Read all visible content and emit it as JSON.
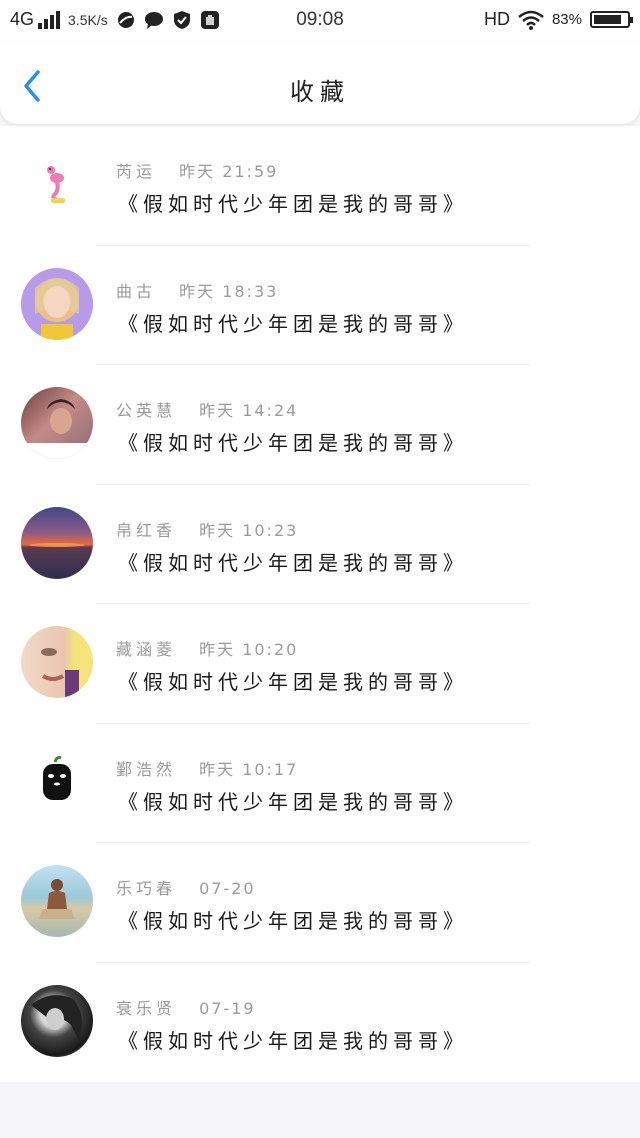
{
  "status_bar": {
    "network": "4G",
    "speed": "3.5K/s",
    "time": "09:08",
    "hd": "HD",
    "battery": "83%",
    "battery_level": 0.83
  },
  "nav": {
    "title": "收藏",
    "back_icon": "chevron-left-icon"
  },
  "items": [
    {
      "name": "芮运",
      "time": "昨天 21:59",
      "content": "《假如时代少年团是我的哥哥》",
      "avatar": "flamingo-sticker"
    },
    {
      "name": "曲古",
      "time": "昨天 18:33",
      "content": "《假如时代少年团是我的哥哥》",
      "avatar": "blonde-girl-photo"
    },
    {
      "name": "公英慧",
      "time": "昨天 14:24",
      "content": "《假如时代少年团是我的哥哥》",
      "avatar": "girl-selfie-photo"
    },
    {
      "name": "帛红香",
      "time": "昨天 10:23",
      "content": "《假如时代少年团是我的哥哥》",
      "avatar": "sunset-sea-photo"
    },
    {
      "name": "藏涵菱",
      "time": "昨天 10:20",
      "content": "《假如时代少年团是我的哥哥》",
      "avatar": "face-closeup-photo"
    },
    {
      "name": "鄞浩然",
      "time": "昨天 10:17",
      "content": "《假如时代少年团是我的哥哥》",
      "avatar": "no-face-ghost"
    },
    {
      "name": "乐巧春",
      "time": "07-20",
      "content": "《假如时代少年团是我的哥哥》",
      "avatar": "man-on-beach-photo"
    },
    {
      "name": "衰乐贤",
      "time": "07-19",
      "content": "《假如时代少年团是我的哥哥》",
      "avatar": "bw-girl-photo"
    }
  ],
  "colors": {
    "accent": "#2a8ee8",
    "name_text": "#9a9a9a",
    "content_text": "#1a1a1a"
  }
}
